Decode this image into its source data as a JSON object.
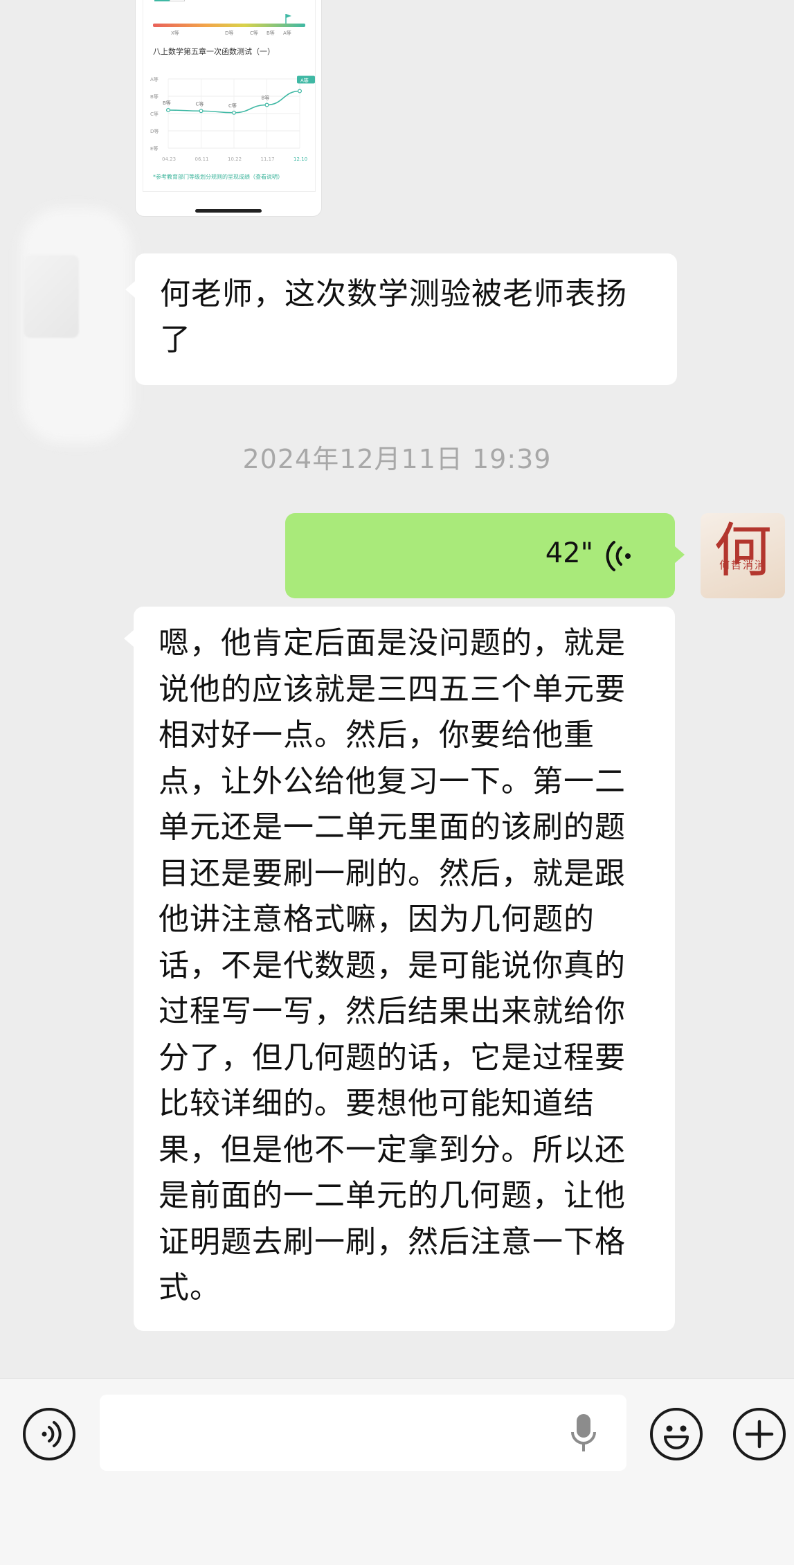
{
  "shared_image": {
    "tabs": [
      "",
      ""
    ],
    "grade_scale": [
      "X等",
      "D等",
      "C等",
      "B等",
      "A等"
    ],
    "chart_title": "八上数学第五章一次函数测试（一）",
    "footnote": "*参考教育部门等级划分规则的呈现成绩（查看说明）",
    "chart_data": {
      "type": "line",
      "categories": [
        "04.23",
        "06.11",
        "10.22",
        "11.17",
        "12.10"
      ],
      "y_labels": [
        "A等",
        "B等",
        "C等",
        "D等",
        "E等"
      ],
      "series": [
        {
          "values": [
            2.2,
            2.15,
            2.05,
            2.5,
            3.3
          ]
        }
      ],
      "point_labels": [
        "B等",
        "C等",
        "C等",
        "B等",
        "A等"
      ]
    }
  },
  "messages": [
    {
      "side": "left",
      "type": "text",
      "text": "何老师，这次数学测验被老师表扬了"
    },
    {
      "type": "timestamp",
      "text": "2024年12月11日 19:39"
    },
    {
      "side": "right",
      "type": "voice",
      "duration": "42\""
    },
    {
      "side": "left",
      "type": "text",
      "text": "嗯，他肯定后面是没问题的，就是说他的应该就是三四五三个单元要相对好一点。然后，你要给他重点，让外公给他复习一下。第一二单元还是一二单元里面的该刷的题目还是要刷一刷的。然后，就是跟他讲注意格式嘛，因为几何题的话，不是代数题，是可能说你真的过程写一写，然后结果出来就给你分了，但几何题的话，它是过程要比较详细的。要想他可能知道结果，但是他不一定拿到分。所以还是前面的一二单元的几何题，让他证明题去刷一刷，然后注意一下格式。"
    }
  ],
  "avatar_right": {
    "char": "何",
    "sub": "何哲消消"
  },
  "input_bar": {
    "placeholder": ""
  },
  "colors": {
    "voice_bubble": "#a9ea7a",
    "chart_line": "#3fb8a4",
    "background": "#ededed"
  }
}
